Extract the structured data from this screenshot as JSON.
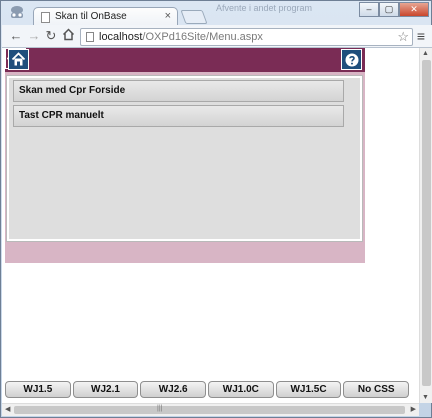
{
  "browser": {
    "tab_title": "Skan til OnBase",
    "tab_close": "×",
    "background_text": "Afvente i andet program",
    "window_buttons": [
      "–",
      "▢",
      "✕"
    ],
    "url_host": "localhost",
    "url_path": "/OXPd16Site/Menu.aspx",
    "icons": [
      "back-icon",
      "forward-icon",
      "reload-icon",
      "home-icon",
      "star-icon",
      "menu-icon"
    ]
  },
  "app": {
    "colors": {
      "header": "#7a2c55",
      "icon_button": "#1e4e7c",
      "panel": "#dedede",
      "panel_border_band": "#d8b5c5"
    },
    "menu_items": [
      {
        "label": "Skan med Cpr Forside"
      },
      {
        "label": "Tast CPR manuelt"
      }
    ],
    "css_buttons": [
      {
        "label": "WJ1.5"
      },
      {
        "label": "WJ2.1"
      },
      {
        "label": "WJ2.6"
      },
      {
        "label": "WJ1.0C"
      },
      {
        "label": "WJ1.5C"
      },
      {
        "label": "No CSS"
      }
    ]
  }
}
